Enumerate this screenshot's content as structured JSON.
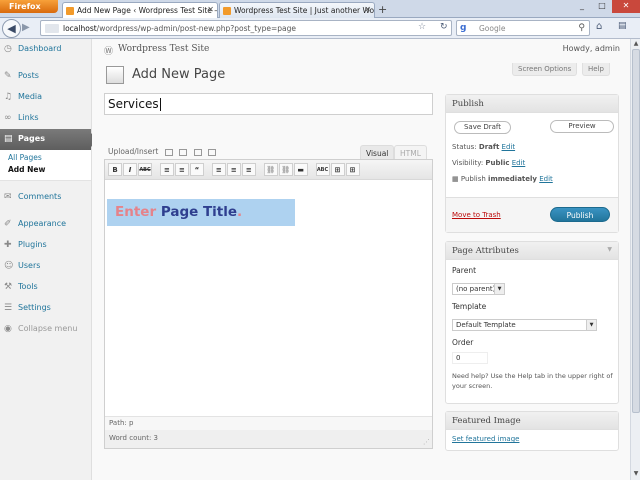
{
  "browser": {
    "menu_button": "Firefox",
    "tabs": [
      {
        "title": "Add New Page ‹ Wordpress Test Site — WordPress",
        "active": true
      },
      {
        "title": "Wordpress Test Site | Just another WordPress site",
        "active": false
      }
    ],
    "new_tab": "+",
    "url_host": "localhost",
    "url_path": "/wordpress/wp-admin/post-new.php?post_type=page",
    "search_placeholder": "Google",
    "search_engine_icon": "google-g-icon",
    "window_controls": [
      "_",
      "□",
      "✕"
    ]
  },
  "admin_menu": {
    "items": [
      {
        "label": "Dashboard",
        "icon": "dashboard-icon"
      },
      {
        "label": "Posts",
        "icon": "pin-icon"
      },
      {
        "label": "Media",
        "icon": "media-icon"
      },
      {
        "label": "Links",
        "icon": "link-icon"
      },
      {
        "label": "Pages",
        "icon": "pages-icon",
        "current": true
      },
      {
        "label": "Comments",
        "icon": "comment-icon"
      },
      {
        "label": "Appearance",
        "icon": "appearance-icon"
      },
      {
        "label": "Plugins",
        "icon": "plugin-icon"
      },
      {
        "label": "Users",
        "icon": "users-icon"
      },
      {
        "label": "Tools",
        "icon": "tools-icon"
      },
      {
        "label": "Settings",
        "icon": "settings-icon"
      }
    ],
    "pages_submenu": [
      "All Pages",
      "Add New"
    ],
    "collapse_label": "Collapse menu"
  },
  "header": {
    "site_name": "Wordpress Test Site",
    "howdy": "Howdy, admin",
    "screen_options": "Screen Options",
    "help": "Help"
  },
  "page": {
    "heading": "Add New Page",
    "title_value": "Services"
  },
  "editor": {
    "upload_label": "Upload/Insert",
    "tab_visual": "Visual",
    "tab_html": "HTML",
    "toolbar_buttons": [
      "B",
      "I",
      "ABC",
      "≡",
      "≡",
      "“",
      "≡",
      "≡",
      "≡",
      "⛓",
      "⛓",
      "▬",
      "ABC",
      "⊞",
      "⊞"
    ],
    "content_image_text": {
      "word1": "Enter",
      "word2": "Page Title",
      "dot": "."
    },
    "path_label": "Path: p",
    "word_count": "Word count: 3"
  },
  "publish": {
    "title": "Publish",
    "save_draft": "Save Draft",
    "preview": "Preview",
    "status_label": "Status:",
    "status_value": "Draft",
    "status_edit": "Edit",
    "visibility_label": "Visibility:",
    "visibility_value": "Public",
    "visibility_edit": "Edit",
    "schedule_label": "Publish",
    "schedule_value": "immediately",
    "schedule_edit": "Edit",
    "trash": "Move to Trash",
    "publish_button": "Publish"
  },
  "page_attributes": {
    "title": "Page Attributes",
    "parent_label": "Parent",
    "parent_value": "(no parent)",
    "template_label": "Template",
    "template_value": "Default Template",
    "order_label": "Order",
    "order_value": "0",
    "help_text": "Need help? Use the Help tab in the upper right of your screen."
  },
  "featured_image": {
    "title": "Featured Image",
    "link": "Set featured image"
  },
  "colors": {
    "link": "#21759b",
    "current_menu": "#6a6a6a",
    "publish_button": "#21759b",
    "trash": "#bc0b0b",
    "title_image_bg": "#aed2f0"
  }
}
